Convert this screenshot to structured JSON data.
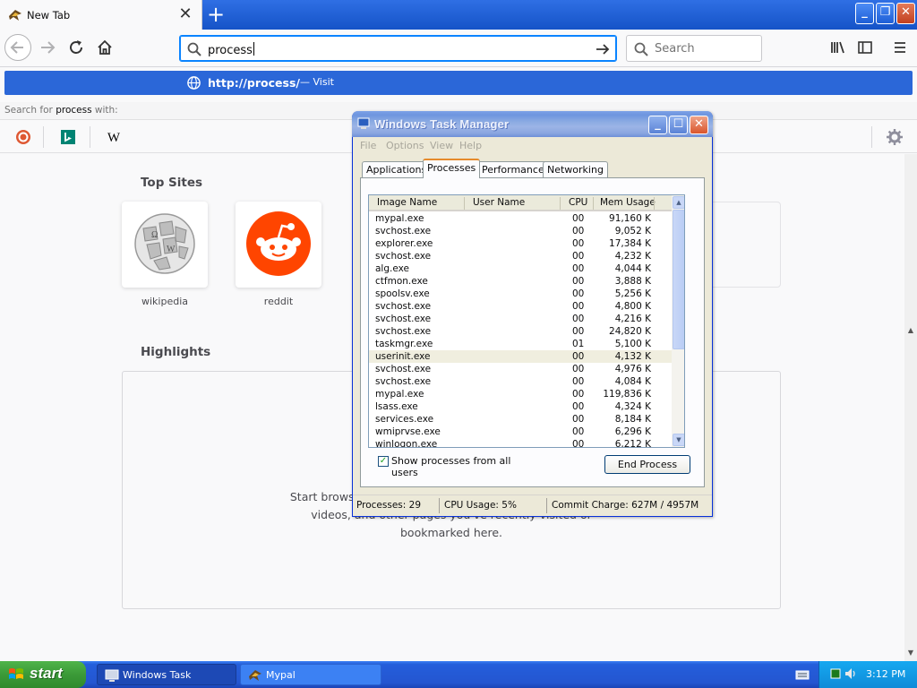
{
  "browser": {
    "tab_title": "New Tab",
    "url_value": "process",
    "search_placeholder": "Search",
    "suggestion_url": "http://process/",
    "suggestion_action": "— Visit",
    "search_with_prefix": "Search for",
    "search_with_term": "process",
    "search_with_suffix": "with:"
  },
  "newtab": {
    "top_sites_title": "Top Sites",
    "sites": [
      {
        "label": "wikipedia"
      },
      {
        "label": "reddit"
      }
    ],
    "highlights_title": "Highlights",
    "highlights_lines": [
      "Start browsing, and we'll show some of the great articles,",
      "videos, and other pages you've recently visited or",
      "bookmarked here."
    ]
  },
  "taskmgr": {
    "title": "Windows Task Manager",
    "menu": [
      "File",
      "Options",
      "View",
      "Help"
    ],
    "tabs": [
      "Applications",
      "Processes",
      "Performance",
      "Networking"
    ],
    "columns": [
      "Image Name",
      "User Name",
      "CPU",
      "Mem Usage"
    ],
    "processes": [
      {
        "name": "mypal.exe",
        "cpu": "00",
        "mem": "91,160 K"
      },
      {
        "name": "svchost.exe",
        "cpu": "00",
        "mem": "9,052 K"
      },
      {
        "name": "explorer.exe",
        "cpu": "00",
        "mem": "17,384 K"
      },
      {
        "name": "svchost.exe",
        "cpu": "00",
        "mem": "4,232 K"
      },
      {
        "name": "alg.exe",
        "cpu": "00",
        "mem": "4,044 K"
      },
      {
        "name": "ctfmon.exe",
        "cpu": "00",
        "mem": "3,888 K"
      },
      {
        "name": "spoolsv.exe",
        "cpu": "00",
        "mem": "5,256 K"
      },
      {
        "name": "svchost.exe",
        "cpu": "00",
        "mem": "4,800 K"
      },
      {
        "name": "svchost.exe",
        "cpu": "00",
        "mem": "4,216 K"
      },
      {
        "name": "svchost.exe",
        "cpu": "00",
        "mem": "24,820 K"
      },
      {
        "name": "taskmgr.exe",
        "cpu": "01",
        "mem": "5,100 K"
      },
      {
        "name": "userinit.exe",
        "cpu": "00",
        "mem": "4,132 K",
        "selected": true
      },
      {
        "name": "svchost.exe",
        "cpu": "00",
        "mem": "4,976 K"
      },
      {
        "name": "svchost.exe",
        "cpu": "00",
        "mem": "4,084 K"
      },
      {
        "name": "mypal.exe",
        "cpu": "00",
        "mem": "119,836 K"
      },
      {
        "name": "lsass.exe",
        "cpu": "00",
        "mem": "4,324 K"
      },
      {
        "name": "services.exe",
        "cpu": "00",
        "mem": "8,184 K"
      },
      {
        "name": "wmiprvse.exe",
        "cpu": "00",
        "mem": "6,296 K"
      },
      {
        "name": "winlogon.exe",
        "cpu": "00",
        "mem": "6,212 K"
      }
    ],
    "show_all_label": "Show processes from all users",
    "show_all_checked": true,
    "end_process_label": "End Process",
    "status_processes": "Processes: 29",
    "status_cpu": "CPU Usage: 5%",
    "status_commit": "Commit Charge: 627M / 4957M"
  },
  "taskbar": {
    "start_label": "start",
    "buttons": [
      "Windows Task Manager",
      "Mypal"
    ],
    "clock": "3:12 PM"
  },
  "colors": {
    "accent": "#0a84ff",
    "url_suggestion_bg": "#2b67d8",
    "xp_taskbar": "#245edb",
    "xp_start_green": "#3b9a38"
  }
}
